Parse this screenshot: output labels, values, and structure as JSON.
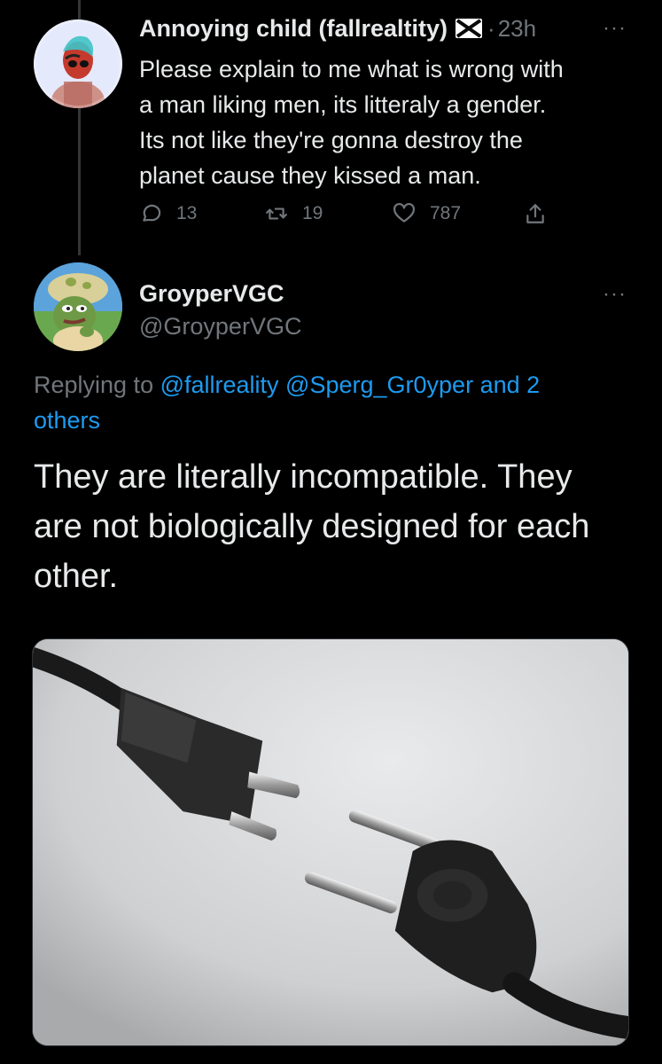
{
  "tweet1": {
    "display_name": "Annoying child (fallrealtity)",
    "flag_icon": "scotland-flag-icon",
    "separator": "·",
    "time": "23h",
    "more_icon": "···",
    "text_lines": [
      "Please explain to me what is wrong with",
      "a man liking men, its litteraly a gender.",
      "Its not like they're gonna destroy the",
      "planet cause they kissed a man."
    ],
    "replies": "13",
    "retweets": "19",
    "likes": "787"
  },
  "tweet2": {
    "display_name": "GroyperVGC",
    "handle": "@GroyperVGC",
    "more_icon": "···",
    "replying_prefix": "Replying to",
    "replying_links": "@fallreality @Sperg_Gr0yper and 2",
    "replying_others": "others",
    "text_lines": [
      "They are literally incompatible. They",
      "are not biologically designed for each",
      "other."
    ],
    "photo": "power-plug-photo"
  },
  "colors": {
    "background": "#000000",
    "text_primary": "#e7e9ea",
    "text_secondary": "#71767b",
    "link": "#1d9bf0"
  }
}
